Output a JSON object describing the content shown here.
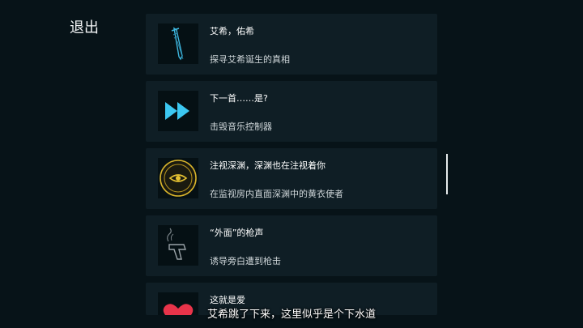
{
  "exit_label": "退出",
  "achievements": [
    {
      "title": "艾希，佑希",
      "desc": "探寻艾希诞生的真相",
      "icon": "katana-icon"
    },
    {
      "title": "下一首……是?",
      "desc": "击毁音乐控制器",
      "icon": "fast-forward-icon"
    },
    {
      "title": "注视深渊，深渊也在注视着你",
      "desc": "在监视房内直面深渊中的黄衣使者",
      "icon": "yellow-eye-icon"
    },
    {
      "title": "“外面”的枪声",
      "desc": "诱导旁白遭到枪击",
      "icon": "smoking-gun-icon"
    },
    {
      "title": "这就是爱",
      "desc": "",
      "icon": "heart-icon"
    }
  ],
  "subtitle": "艾希跳了下来，这里似乎是个下水道",
  "colors": {
    "accent_cyan": "#38c7f0",
    "accent_gold": "#e6c232",
    "heart_red": "#e8344a"
  }
}
